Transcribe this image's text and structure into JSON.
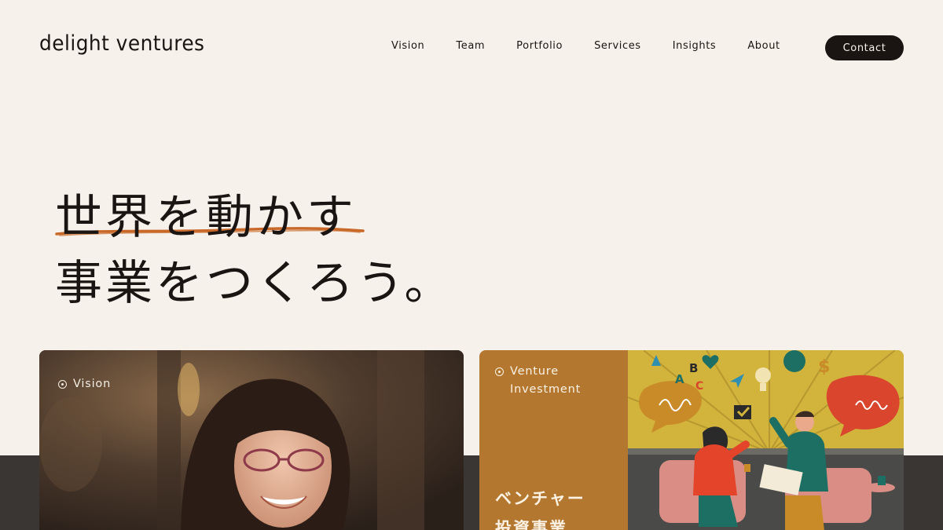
{
  "brand": {
    "logo": "delight ventures"
  },
  "nav": {
    "items": [
      "Vision",
      "Team",
      "Portfolio",
      "Services",
      "Insights",
      "About"
    ],
    "contact": "Contact"
  },
  "hero": {
    "line1": "世界を動かす",
    "line2": "事業をつくろう。",
    "accent_color": "#c8692a"
  },
  "cards": {
    "vision": {
      "label": "Vision"
    },
    "venture": {
      "label_line1": "Venture",
      "label_line2": "Investment",
      "title_line1": "ベンチャー",
      "title_line2": "投資事業"
    }
  },
  "colors": {
    "background": "#f6f1ea",
    "text": "#1a1512",
    "card_orange": "#b47730",
    "dark_band": "#393634"
  }
}
